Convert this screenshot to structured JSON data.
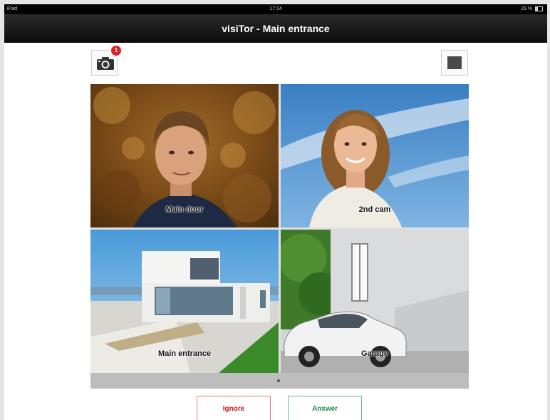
{
  "status_bar": {
    "device": "iPad",
    "time": "17:14",
    "battery": "29 %"
  },
  "title_bar": {
    "title": "visiTor - Main entrance"
  },
  "toolbar": {
    "camera_icon": "camera-icon",
    "camera_badge": "1",
    "stop_icon": "stop-icon"
  },
  "cameras": [
    {
      "label": "Main door"
    },
    {
      "label": "2nd cam"
    },
    {
      "label": "Main entrance"
    },
    {
      "label": "Garage"
    }
  ],
  "actions": {
    "ignore_label": "Ignore",
    "answer_label": "Answer"
  },
  "colors": {
    "ignore": "#d01818",
    "answer": "#1a8a4a",
    "badge": "#e02020"
  }
}
